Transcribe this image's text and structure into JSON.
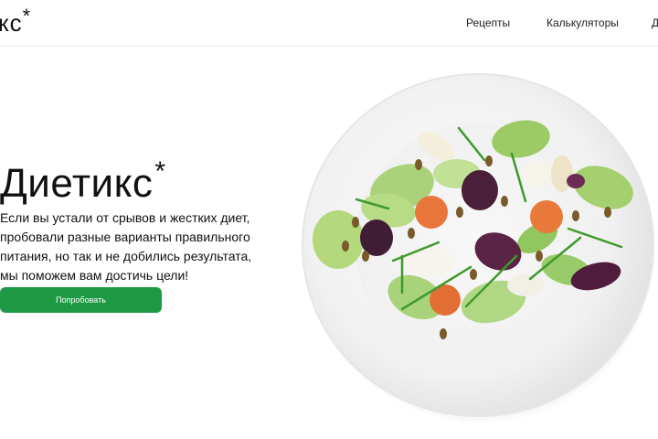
{
  "header": {
    "logo_text": "кс",
    "logo_star": "*",
    "nav": {
      "recipes": "Рецепты",
      "calculators": "Калькуляторы",
      "more": "Д"
    }
  },
  "hero": {
    "title": "Диетикс",
    "title_star": "*",
    "description": "Если вы устали от срывов и жестких диет, пробовали разные варианты правильного питания, но так и не добились результата, мы поможем вам достичь цели!",
    "cta_label": "Попробовать"
  },
  "colors": {
    "accent": "#1f9a44",
    "text": "#111111",
    "background": "#ffffff"
  },
  "image": {
    "subject": "salad-plate"
  }
}
